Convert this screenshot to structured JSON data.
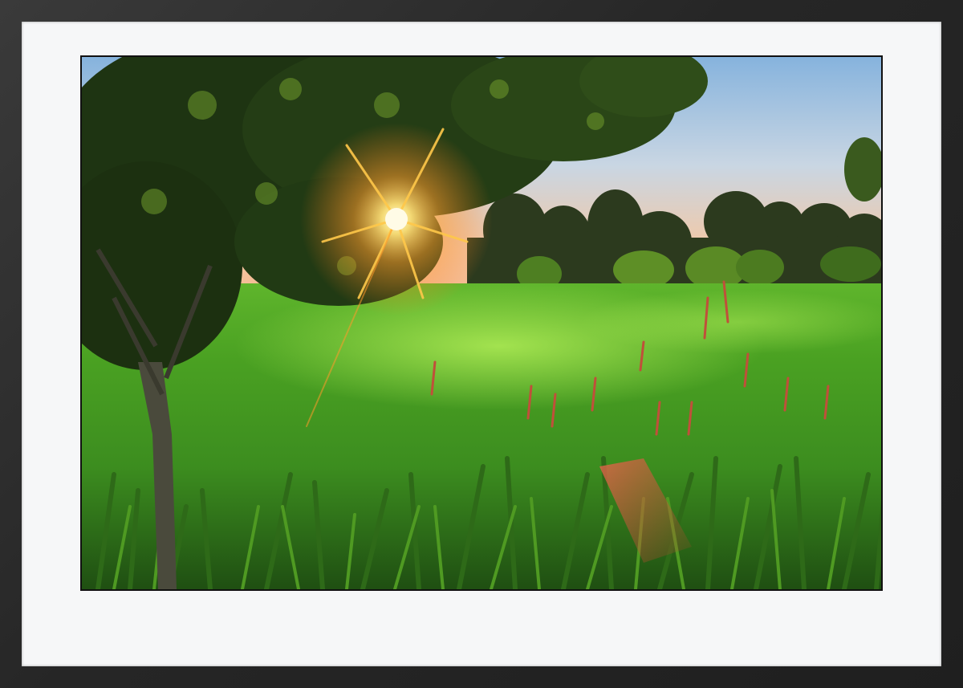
{
  "frame": {
    "color": "#2b2b2b"
  },
  "mat": {
    "color": "#f6f7f8"
  },
  "photo": {
    "subject": "sun-through-tree-over-meadow",
    "palette": {
      "sky_top": "#8fb7dc",
      "sky_horizon": "#f3c7a6",
      "sun": "#fff6c8",
      "grass_bright": "#7fd83a",
      "grass_dark": "#2f6a1c",
      "foliage": "#2d4a1a",
      "reed_tips": "#c0503a"
    }
  }
}
